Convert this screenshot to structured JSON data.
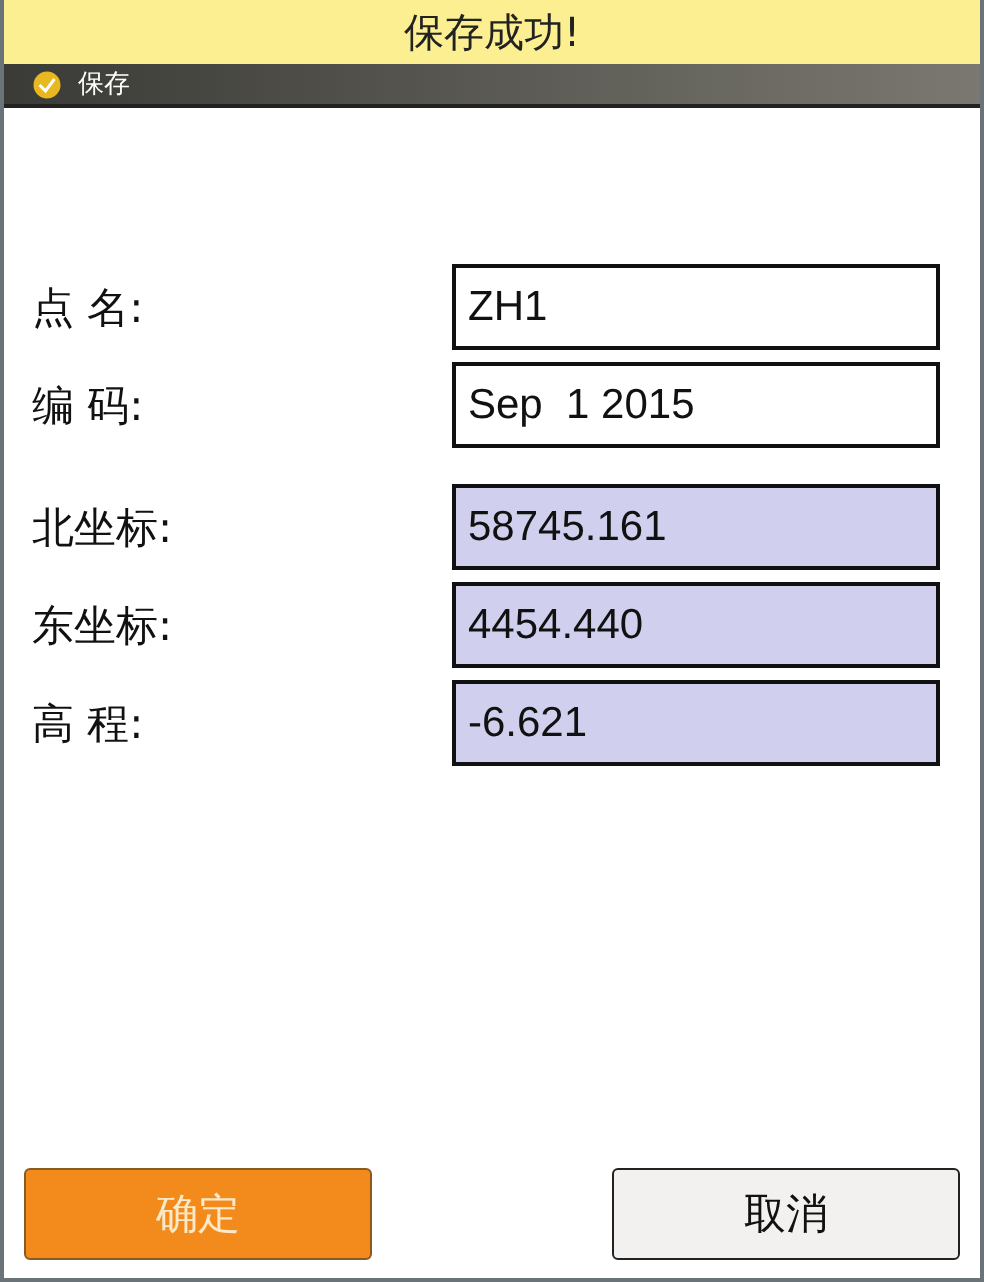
{
  "toast": "保存成功!",
  "window": {
    "title": "保存"
  },
  "fields": [
    {
      "label": "点 名:",
      "value": "ZH1",
      "editable": true
    },
    {
      "label": "编 码:",
      "value": "Sep  1 2015",
      "editable": true
    },
    {
      "label": "北坐标:",
      "value": "58745.161",
      "editable": false
    },
    {
      "label": "东坐标:",
      "value": "4454.440",
      "editable": false
    },
    {
      "label": "高 程:",
      "value": "-6.621",
      "editable": false
    }
  ],
  "buttons": [
    {
      "label": "确定",
      "kind": "primary"
    },
    {
      "label": "取消",
      "kind": "secondary"
    }
  ]
}
